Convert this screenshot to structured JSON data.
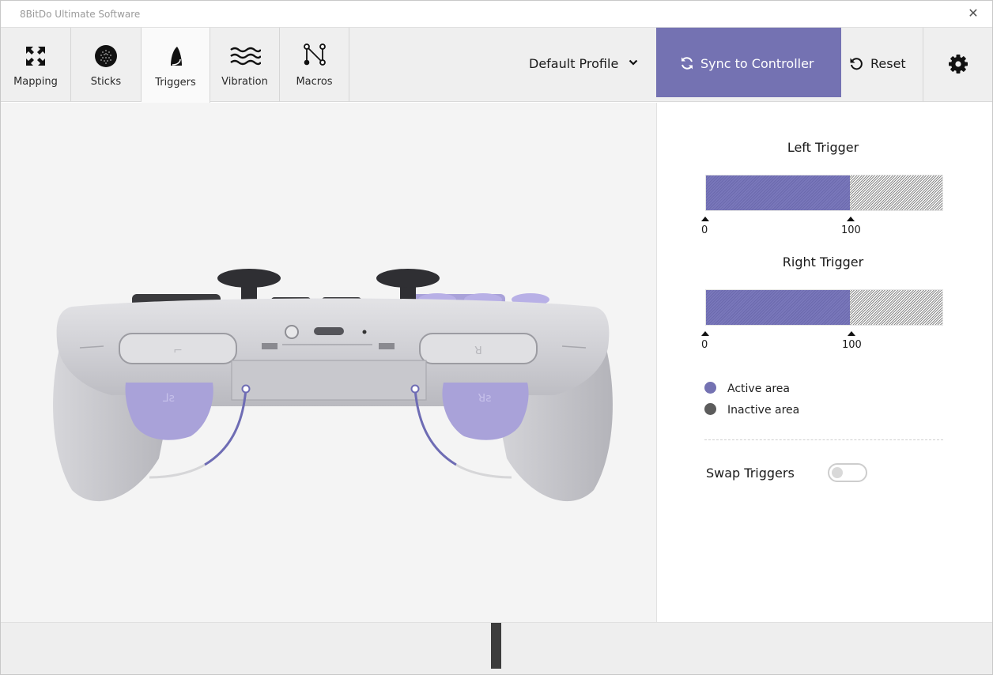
{
  "window": {
    "title": "8BitDo Ultimate Software",
    "close_glyph": "✕"
  },
  "tabs": [
    {
      "label": "Mapping",
      "icon": "mapping-arrows-icon"
    },
    {
      "label": "Sticks",
      "icon": "stick-dotted-icon"
    },
    {
      "label": "Triggers",
      "icon": "trigger-icon",
      "active": true
    },
    {
      "label": "Vibration",
      "icon": "vibration-waves-icon"
    },
    {
      "label": "Macros",
      "icon": "macro-nodes-icon"
    }
  ],
  "profile": {
    "label": "Default Profile"
  },
  "actions": {
    "sync_label": "Sync to Controller",
    "reset_label": "Reset"
  },
  "triggers": {
    "left": {
      "title": "Left Trigger",
      "min_label": "0",
      "max_label": "100",
      "active_start": 0,
      "active_end": 100,
      "fill_fraction": 0.61
    },
    "right": {
      "title": "Right Trigger",
      "min_label": "0",
      "max_label": "100",
      "active_start": 0,
      "active_end": 100,
      "fill_fraction": 0.61
    }
  },
  "legend": {
    "active": "Active area",
    "inactive": "Inactive area"
  },
  "swap": {
    "label": "Swap Triggers",
    "enabled": false
  },
  "colors": {
    "accent": "#7472b2",
    "active_dot": "#7472b2",
    "inactive_dot": "#5c5c5c",
    "toolbar_bg": "#efefef"
  }
}
